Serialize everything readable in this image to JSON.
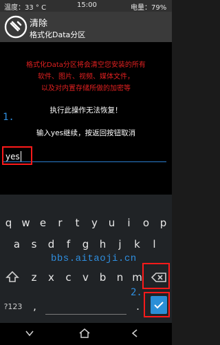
{
  "status_bar": {
    "temperature": "温度：33 ° C",
    "time": "15:00",
    "battery": "电量：79%"
  },
  "header": {
    "title": "清除",
    "subtitle": "格式化Data分区"
  },
  "warning": [
    "格式化Data分区将会清空您安装的所有",
    "软件、图片、视频、媒体文件，",
    "以及对内置存储所做的加密等"
  ],
  "info": {
    "irreversible": "执行此操作无法恢复！",
    "prompt": "输入yes继续，按返回按钮取消"
  },
  "input": {
    "value": "yes"
  },
  "annotations": {
    "step1": "1.",
    "step2": "2."
  },
  "keyboard": {
    "row1": [
      "q",
      "w",
      "e",
      "r",
      "t",
      "y",
      "u",
      "i",
      "o",
      "p"
    ],
    "row2": [
      "a",
      "s",
      "d",
      "f",
      "g",
      "h",
      "j",
      "k",
      "l"
    ],
    "row3": [
      "z",
      "x",
      "c",
      "v",
      "b",
      "n",
      "m"
    ],
    "symbols_label": "?123",
    "comma": ",",
    "period": ".",
    "watermark": "bbs.aitaoji.cn"
  },
  "colors": {
    "accent": "#2a8fd7",
    "warning": "#e02020",
    "highlight": "#ff1a1a"
  }
}
